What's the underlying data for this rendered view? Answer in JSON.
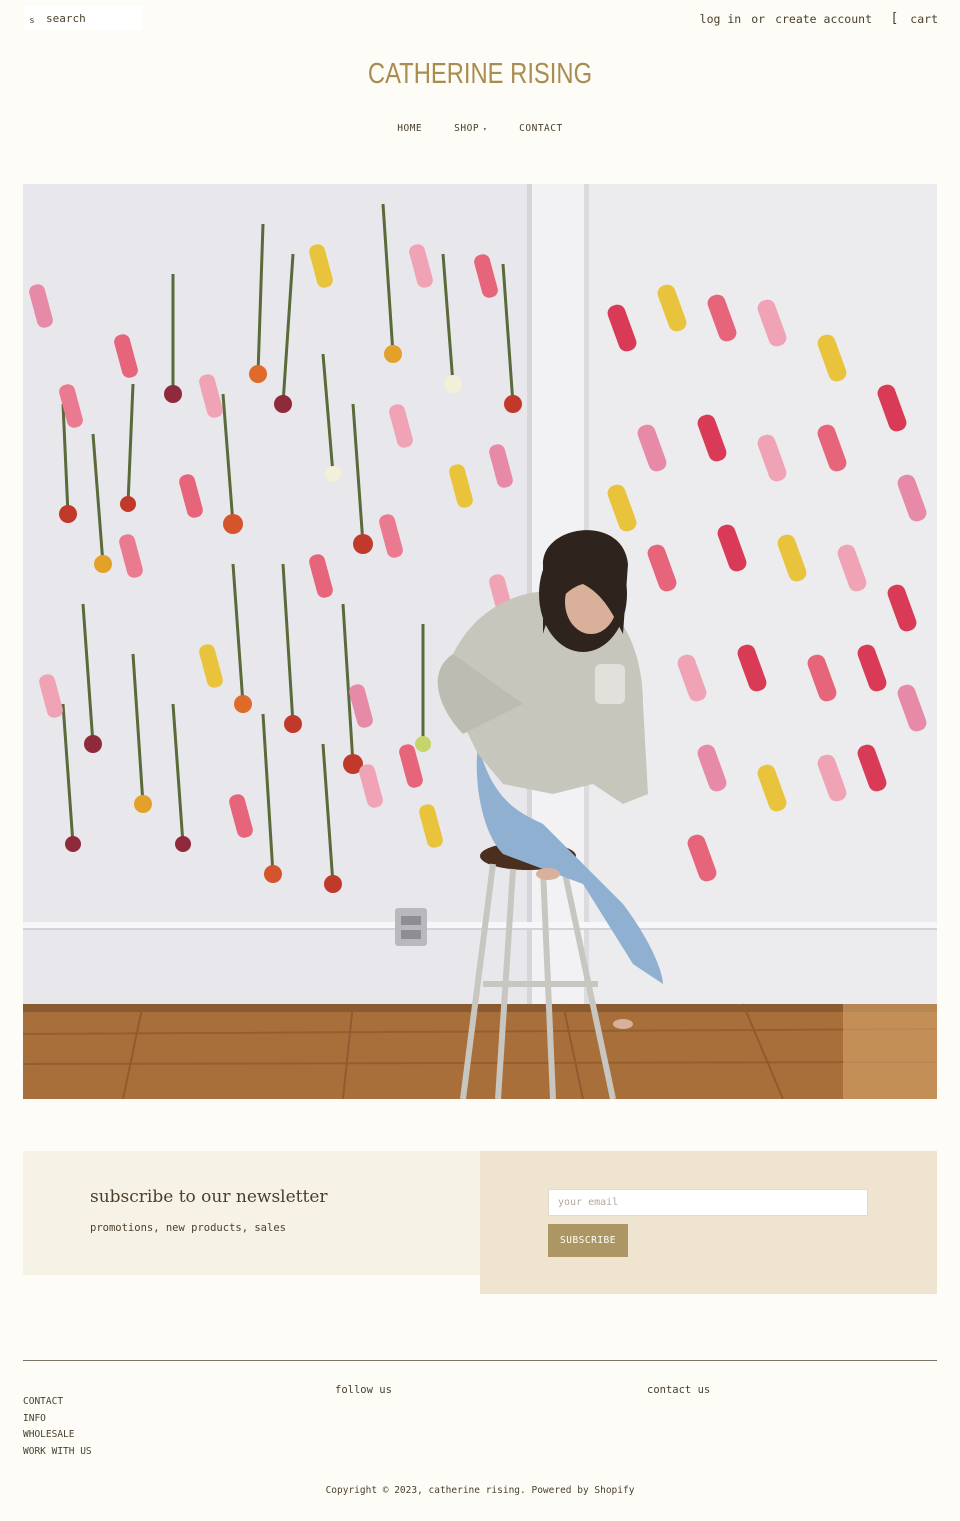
{
  "header": {
    "search_placeholder": "search",
    "search_icon": "s",
    "log_in": "log in",
    "or": "or",
    "create_account": "create account",
    "cart_icon": "[",
    "cart_label": "cart"
  },
  "logo": "CATHERINE RISING",
  "nav": {
    "home": "HOME",
    "shop": "SHOP",
    "shop_caret": "▾",
    "contact": "CONTACT"
  },
  "hero": {
    "image_description": "woman seated on a stool in front of a wall of hanging dried flower bundles",
    "colors": {
      "wall": "#e8e8ec",
      "floor": "#a86f3a",
      "pillar": "#f2f2f4"
    }
  },
  "newsletter": {
    "title": "subscribe to our newsletter",
    "subtitle": "promotions, new products, sales",
    "email_placeholder": "your email",
    "button": "SUBSCRIBE"
  },
  "footer": {
    "links": [
      "CONTACT",
      "INFO",
      "WHOLESALE",
      "WORK WITH US"
    ],
    "follow_heading": "follow us",
    "contact_heading": "contact us",
    "copyright_prefix": "Copyright © 2023, catherine rising.",
    "powered_by": "Powered by Shopify"
  },
  "colors": {
    "background": "#fdfcf6",
    "brand_gold": "#a98c4f",
    "button": "#ac9764",
    "text": "#4a3f2c"
  }
}
